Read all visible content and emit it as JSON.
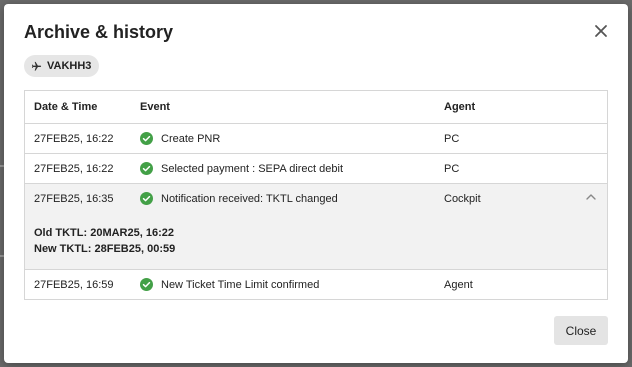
{
  "dialog": {
    "title": "Archive & history",
    "close_icon": "close-icon",
    "pnr_chip": {
      "icon": "plane-icon",
      "label": "VAKHH3"
    }
  },
  "table": {
    "columns": [
      "Date & Time",
      "Event",
      "Agent"
    ],
    "rows": [
      {
        "date": "27FEB25, 16:22",
        "event": "Create PNR",
        "agent": "PC",
        "status_icon": "check-circle-icon"
      },
      {
        "date": "27FEB25, 16:22",
        "event": "Selected payment : SEPA direct debit",
        "agent": "PC",
        "status_icon": "check-circle-icon"
      },
      {
        "date": "27FEB25, 16:35",
        "event": "Notification received: TKTL changed",
        "agent": "Cockpit",
        "status_icon": "check-circle-icon",
        "expanded": true,
        "toggle_icon": "chevron-up-icon",
        "details": {
          "old": "Old TKTL: 20MAR25, 16:22",
          "new": "New TKTL: 28FEB25, 00:59"
        }
      },
      {
        "date": "27FEB25, 16:59",
        "event": "New Ticket Time Limit confirmed",
        "agent": "Agent",
        "status_icon": "check-circle-icon"
      }
    ]
  },
  "footer": {
    "close_label": "Close"
  },
  "colors": {
    "success": "#43a047",
    "chip_bg": "#e6e6e6",
    "expanded_bg": "#f2f2f2",
    "button_bg": "#e4e4e4"
  }
}
